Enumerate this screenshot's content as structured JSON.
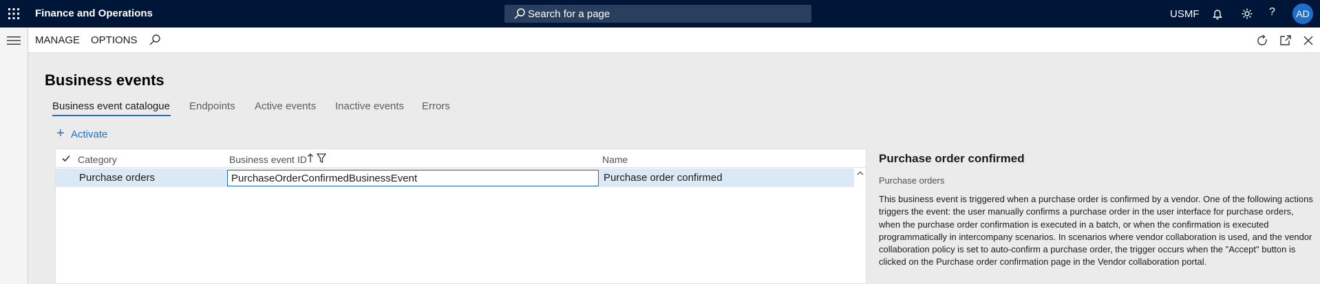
{
  "app": {
    "title": "Finance and Operations",
    "search_placeholder": "Search for a page",
    "company": "USMF",
    "help": "?",
    "avatar_initials": "AD",
    "colors": {
      "topbar": "#001639",
      "accent": "#1f6fc9",
      "selected_row": "#dbe8f5"
    }
  },
  "actionpane": {
    "items": [
      "MANAGE",
      "OPTIONS"
    ]
  },
  "page": {
    "title": "Business events",
    "tabs": [
      {
        "label": "Business event catalogue",
        "active": true
      },
      {
        "label": "Endpoints",
        "active": false
      },
      {
        "label": "Active events",
        "active": false
      },
      {
        "label": "Inactive events",
        "active": false
      },
      {
        "label": "Errors",
        "active": false
      }
    ],
    "activate_label": "Activate"
  },
  "grid": {
    "columns": [
      "Category",
      "Business event ID",
      "Name"
    ],
    "rows": [
      {
        "category": "Purchase orders",
        "event_id": "PurchaseOrderConfirmedBusinessEvent",
        "name": "Purchase order confirmed"
      }
    ]
  },
  "details": {
    "title": "Purchase order confirmed",
    "category": "Purchase orders",
    "description": "This business event is triggered when a purchase order is confirmed by a vendor. One of the following actions triggers the event: the user manually confirms a purchase order in the user interface for purchase orders, when the purchase order confirmation is executed in a batch, or when the confirmation is executed programmatically in intercompany scenarios. In scenarios where vendor collaboration is used, and the vendor collaboration policy is set to auto-confirm a purchase order, the trigger occurs when the \"Accept\" button is clicked on the Purchase order confirmation page in the Vendor collaboration portal."
  }
}
